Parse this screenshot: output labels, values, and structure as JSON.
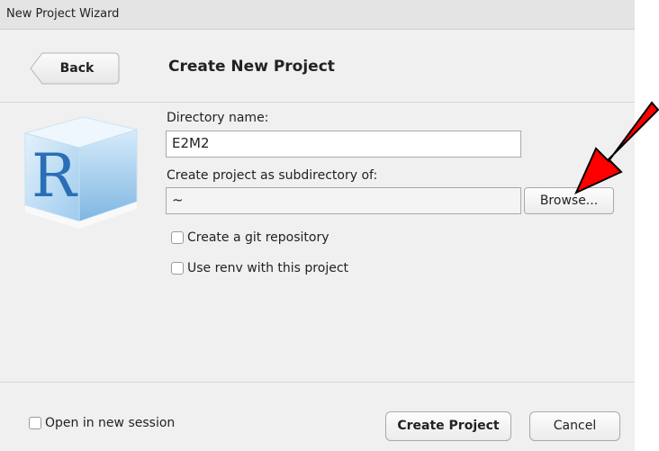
{
  "window": {
    "title": "New Project Wizard"
  },
  "header": {
    "back_label": "Back",
    "page_title": "Create New Project"
  },
  "form": {
    "directory_name_label": "Directory name:",
    "directory_name_value": "E2M2",
    "parent_dir_label": "Create project as subdirectory of:",
    "parent_dir_value": "~",
    "browse_label": "Browse...",
    "git_repo_label": "Create a git repository",
    "git_repo_checked": false,
    "renv_label": "Use renv with this project",
    "renv_checked": false
  },
  "footer": {
    "new_session_label": "Open in new session",
    "new_session_checked": false,
    "create_label": "Create Project",
    "cancel_label": "Cancel"
  },
  "annotation": {
    "arrow_color": "#ff0000"
  },
  "logo": {
    "letter": "R"
  }
}
